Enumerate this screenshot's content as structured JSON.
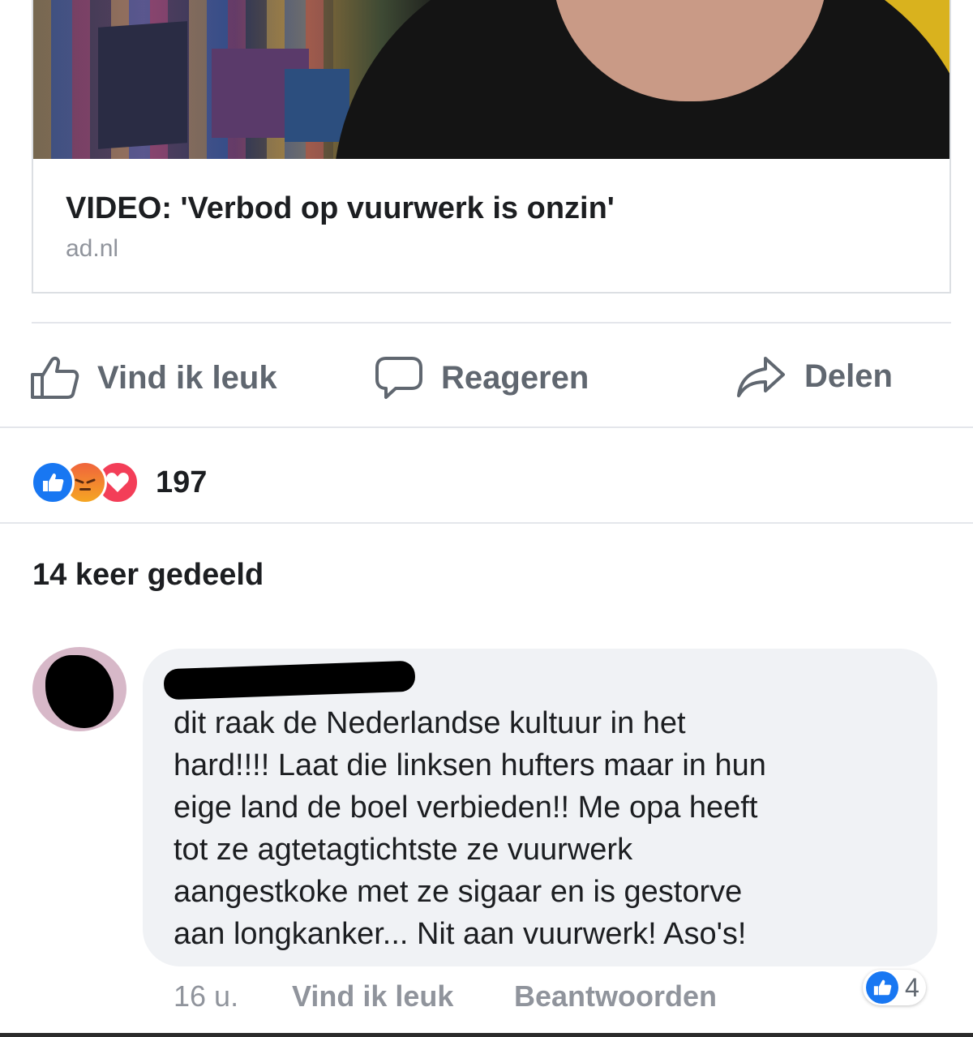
{
  "link_preview": {
    "title": "VIDEO: 'Verbod op vuurwerk is onzin'",
    "domain": "ad.nl"
  },
  "actions": {
    "like": "Vind ik leuk",
    "comment": "Reageren",
    "share": "Delen"
  },
  "reactions": {
    "icons": [
      "like-icon",
      "angry-icon",
      "love-icon"
    ],
    "count": "197"
  },
  "shares_text": "14 keer gedeeld",
  "comment": {
    "author": "",
    "text": "dit raak de Nederlandse kultuur in het\nhard!!!! Laat die linksen hufters maar in hun\neige land de boel verbieden!! Me opa heeft\ntot ze agtetagtichtste ze vuurwerk\naangestkoke met ze sigaar en is gestorve\naan longkanker... Nit aan vuurwerk! Aso's!",
    "time": "16 u.",
    "like_label": "Vind ik leuk",
    "reply_label": "Beantwoorden",
    "like_count": "4"
  },
  "colors": {
    "facebook_blue": "#1877f2",
    "angry_orange": "#f0643c",
    "love_red": "#f33e58",
    "secondary_text": "#606770",
    "comment_bubble": "#f0f2f5"
  }
}
